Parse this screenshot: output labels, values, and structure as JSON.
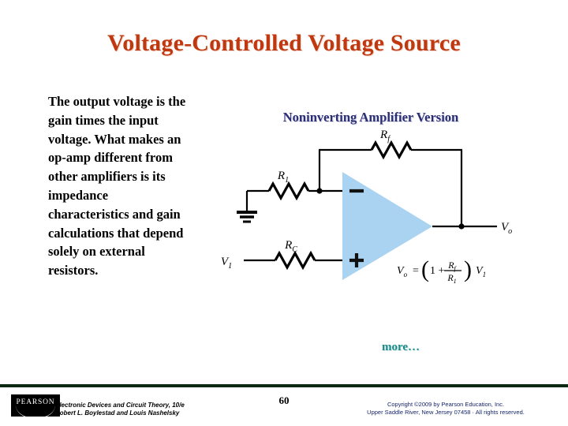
{
  "slide": {
    "title": "Voltage-Controlled Voltage Source",
    "title_color": "#c0380f",
    "background": "#ffffff"
  },
  "body": {
    "paragraph": "The output voltage is the gain times the input voltage. What makes an op-amp different from other amplifiers is its impedance characteristics and gain calculations that depend solely on external resistors."
  },
  "figure": {
    "heading": "Noninverting Amplifier Version",
    "heading_color": "#2b2e75",
    "opamp_fill": "#a9d3f0",
    "labels": {
      "rf": "R",
      "rf_sub": "f",
      "r1": "R",
      "r1_sub": "1",
      "rc": "R",
      "rc_sub": "C",
      "v1": "V",
      "v1_sub": "1",
      "vo": "V",
      "vo_sub": "o",
      "minus": "−",
      "plus": "+"
    },
    "equation": {
      "lhs": "V",
      "lhs_sub": "o",
      "equals": "=",
      "open_paren": "(",
      "one": "1 +",
      "num": "R",
      "num_sub": "f",
      "den": "R",
      "den_sub": "1",
      "close_paren": ")",
      "rhs": "V",
      "rhs_sub": "1",
      "plain": "Vo = (1 + Rf/R1) V1"
    }
  },
  "more_link": {
    "label": "more…",
    "color": "#1d8a8a"
  },
  "footer": {
    "rule_color": "#0d2a12",
    "logo_text": "PEARSON",
    "book_title": "Electronic Devices and Circuit Theory, 10/e",
    "authors": "Robert L. Boylestad and Louis Nashelsky",
    "page_number": "60",
    "copyright_line1": "Copyright ©2009 by Pearson Education, Inc.",
    "copyright_line2": "Upper Saddle River, New Jersey 07458 · All rights reserved."
  }
}
